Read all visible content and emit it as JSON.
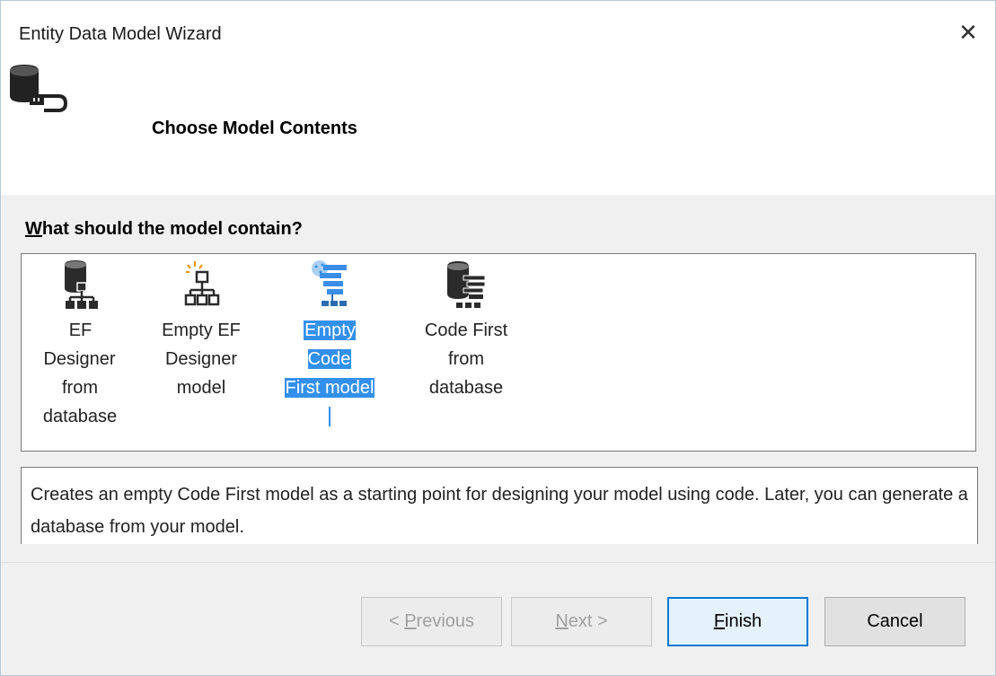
{
  "window": {
    "title": "Entity Data Model Wizard",
    "close_glyph": "✕"
  },
  "header": {
    "icon": "database-connector-icon",
    "heading": "Choose Model Contents"
  },
  "prompt": {
    "accesskey": "W",
    "rest": "hat should the model contain?"
  },
  "options": [
    {
      "icon": "ef-designer-from-database-icon",
      "line1": "EF Designer",
      "line2": "from",
      "line3": "database",
      "selected": false
    },
    {
      "icon": "empty-ef-designer-model-icon",
      "line1": "Empty EF",
      "line2": "Designer",
      "line3": "model",
      "selected": false
    },
    {
      "icon": "empty-code-first-model-icon",
      "line1": "Empty Code",
      "line2": "First model",
      "line3": "",
      "selected": true
    },
    {
      "icon": "code-first-from-database-icon",
      "line1": "Code First",
      "line2": "from",
      "line3": "database",
      "selected": false
    }
  ],
  "description": "Creates an empty Code First model as a starting point for designing your model using code. Later, you can generate a database from your model.",
  "buttons": {
    "previous": {
      "prefix": "< ",
      "accesskey": "P",
      "rest": "revious",
      "enabled": false
    },
    "next": {
      "accesskey": "N",
      "rest": "ext >",
      "enabled": false
    },
    "finish": {
      "accesskey": "F",
      "rest": "inish",
      "enabled": true
    },
    "cancel": {
      "label": "Cancel",
      "enabled": true
    }
  },
  "colors": {
    "selection": "#3390ea",
    "default_button_border": "#0078d7"
  }
}
